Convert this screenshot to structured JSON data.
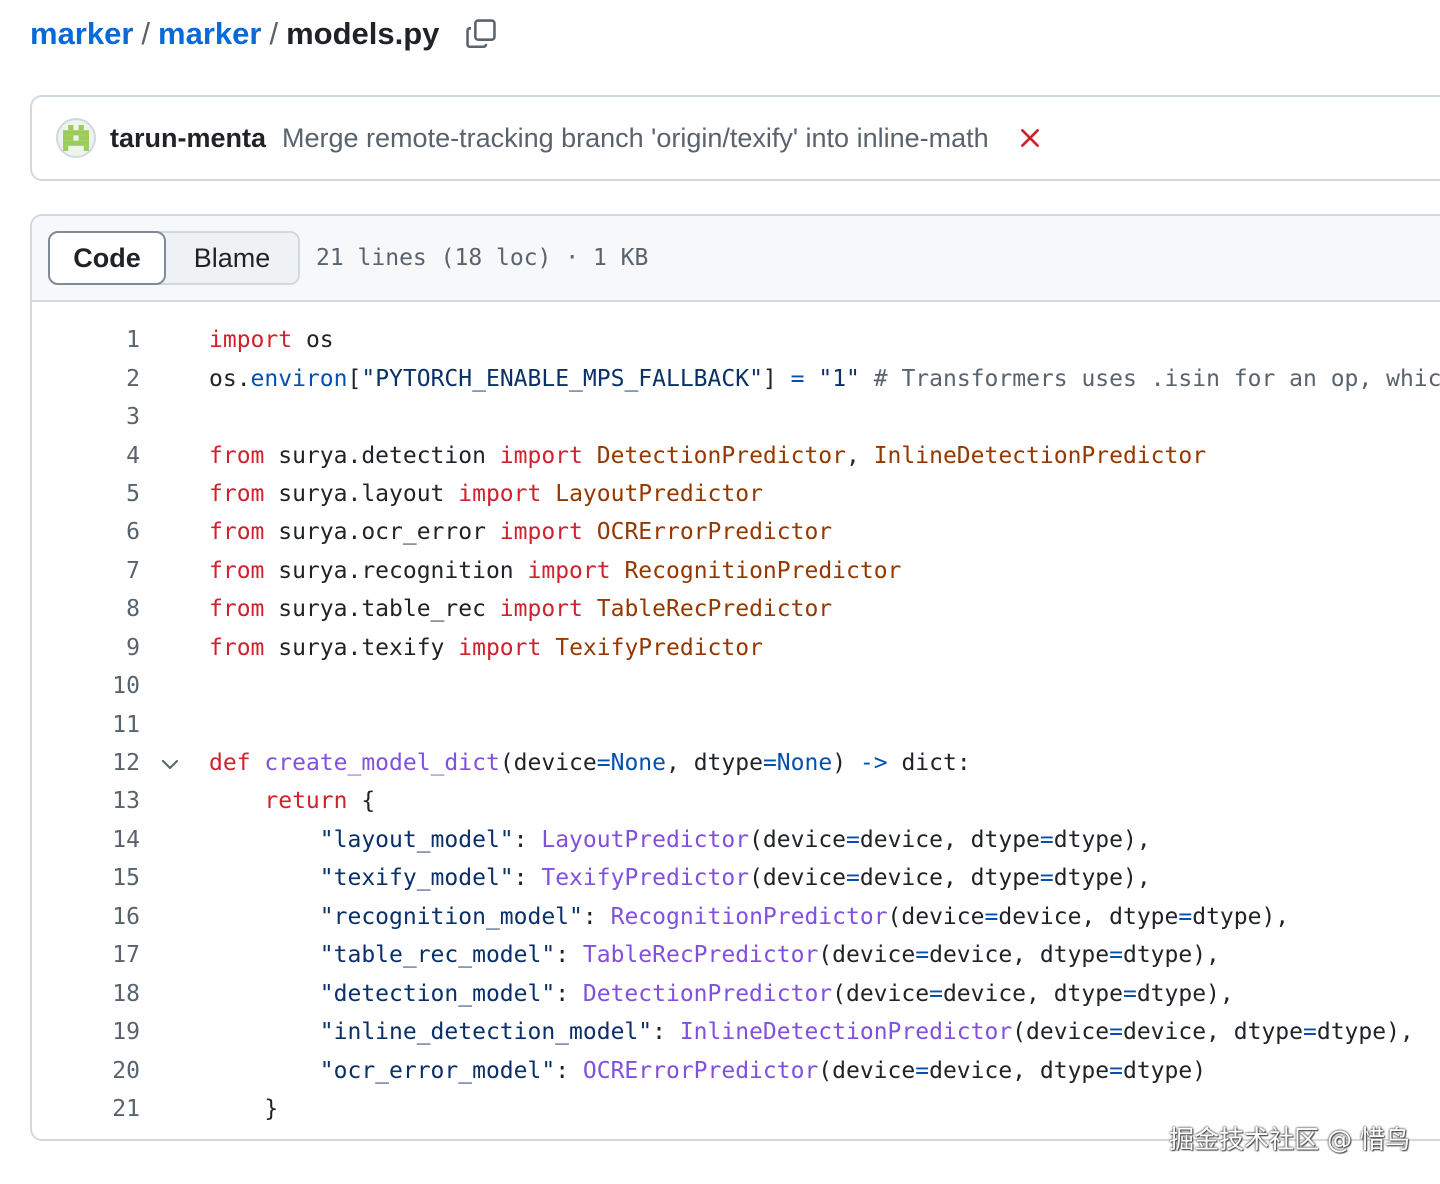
{
  "breadcrumb": {
    "repo_owner": "marker",
    "repo_dir": "marker",
    "separator": "/",
    "file_name": "models.py"
  },
  "commit": {
    "author": "tarun-menta",
    "message": "Merge remote-tracking branch 'origin/texify' into inline-math",
    "status": "failure",
    "status_color": "#cf222e"
  },
  "file_header": {
    "tabs": [
      "Code",
      "Blame"
    ],
    "active_tab": "Code",
    "info": "21 lines (18 loc) · 1 KB"
  },
  "code": {
    "lines": [
      {
        "n": "1",
        "text": "import os"
      },
      {
        "n": "2",
        "text": "os.environ[\"PYTORCH_ENABLE_MPS_FALLBACK\"] = \"1\" # Transformers uses .isin for an op, whic"
      },
      {
        "n": "3",
        "text": ""
      },
      {
        "n": "4",
        "text": "from surya.detection import DetectionPredictor, InlineDetectionPredictor"
      },
      {
        "n": "5",
        "text": "from surya.layout import LayoutPredictor"
      },
      {
        "n": "6",
        "text": "from surya.ocr_error import OCRErrorPredictor"
      },
      {
        "n": "7",
        "text": "from surya.recognition import RecognitionPredictor"
      },
      {
        "n": "8",
        "text": "from surya.table_rec import TableRecPredictor"
      },
      {
        "n": "9",
        "text": "from surya.texify import TexifyPredictor"
      },
      {
        "n": "10",
        "text": ""
      },
      {
        "n": "11",
        "text": ""
      },
      {
        "n": "12",
        "text": "def create_model_dict(device=None, dtype=None) -> dict:"
      },
      {
        "n": "13",
        "text": "    return {"
      },
      {
        "n": "14",
        "text": "        \"layout_model\": LayoutPredictor(device=device, dtype=dtype),"
      },
      {
        "n": "15",
        "text": "        \"texify_model\": TexifyPredictor(device=device, dtype=dtype),"
      },
      {
        "n": "16",
        "text": "        \"recognition_model\": RecognitionPredictor(device=device, dtype=dtype),"
      },
      {
        "n": "17",
        "text": "        \"table_rec_model\": TableRecPredictor(device=device, dtype=dtype),"
      },
      {
        "n": "18",
        "text": "        \"detection_model\": DetectionPredictor(device=device, dtype=dtype),"
      },
      {
        "n": "19",
        "text": "        \"inline_detection_model\": InlineDetectionPredictor(device=device, dtype=dtype),"
      },
      {
        "n": "20",
        "text": "        \"ocr_error_model\": OCRErrorPredictor(device=device, dtype=dtype)"
      },
      {
        "n": "21",
        "text": "    }"
      }
    ],
    "foldable_line": "12"
  },
  "watermark": "掘金技术社区 @ 惜鸟",
  "icons": {
    "copy": "copy-icon",
    "status": "x-icon",
    "fold": "chevron-down-icon",
    "avatar": "identicon"
  }
}
